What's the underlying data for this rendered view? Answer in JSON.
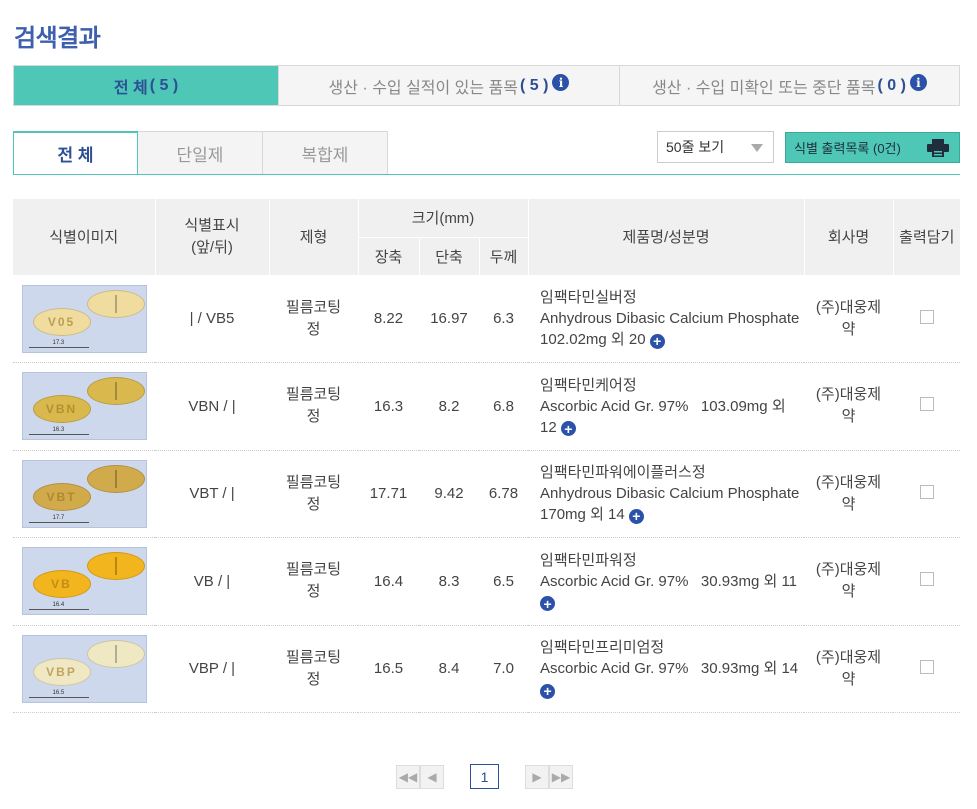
{
  "page_title": "검색결과",
  "top_tabs": [
    {
      "label": "전 체",
      "count": "( 5 )"
    },
    {
      "label": "생산 · 수입 실적이 있는 품목",
      "count": "( 5 )"
    },
    {
      "label": "생산 · 수입 미확인 또는 중단 품목",
      "count": "( 0 )"
    }
  ],
  "sub_tabs": [
    "전 체",
    "단일제",
    "복합제"
  ],
  "view_select": {
    "value": "50줄 보기"
  },
  "print_button": {
    "label": "식별 출력목록 (0건)"
  },
  "table": {
    "headers": {
      "image": "식별이미지",
      "marking": "식별표시\n(앞/뒤)",
      "form": "제형",
      "size": "크기(mm)",
      "long": "장축",
      "short": "단축",
      "thick": "두께",
      "product": "제품명/성분명",
      "company": "회사명",
      "print": "출력담기"
    },
    "rows": [
      {
        "marking": "| / VB5",
        "form": "필름코팅\n정",
        "long": "8.22",
        "short": "16.97",
        "thick": "6.3",
        "product": "임팩타민실버정",
        "ingredient": "Anhydrous Dibasic Calcium Phosphate   102.02mg 외 20",
        "company": "(주)대웅제\n약",
        "pill_color": "#efdc9e",
        "imprint": "V05",
        "scale_label": "17.3"
      },
      {
        "marking": "VBN / |",
        "form": "필름코팅\n정",
        "long": "16.3",
        "short": "8.2",
        "thick": "6.8",
        "product": "임팩타민케어정",
        "ingredient": "Ascorbic Acid Gr. 97%   103.09mg 외 12",
        "company": "(주)대웅제\n약",
        "pill_color": "#d9b94e",
        "imprint": "VBN",
        "scale_label": "16.3"
      },
      {
        "marking": "VBT / |",
        "form": "필름코팅\n정",
        "long": "17.71",
        "short": "9.42",
        "thick": "6.78",
        "product": "임팩타민파워에이플러스정",
        "ingredient": "Anhydrous Dibasic Calcium Phosphate   170mg 외 14",
        "company": "(주)대웅제\n약",
        "pill_color": "#d1aa4c",
        "imprint": "VBT",
        "scale_label": "17.7"
      },
      {
        "marking": "VB / |",
        "form": "필름코팅\n정",
        "long": "16.4",
        "short": "8.3",
        "thick": "6.5",
        "product": "임팩타민파워정",
        "ingredient": "Ascorbic Acid Gr. 97%   30.93mg 외 11",
        "company": "(주)대웅제\n약",
        "pill_color": "#f3b51d",
        "imprint": "VB",
        "scale_label": "16.4"
      },
      {
        "marking": "VBP / |",
        "form": "필름코팅\n정",
        "long": "16.5",
        "short": "8.4",
        "thick": "7.0",
        "product": "임팩타민프리미엄정",
        "ingredient": "Ascorbic Acid Gr. 97%   30.93mg 외 14",
        "company": "(주)대웅제\n약",
        "pill_color": "#efe8c2",
        "imprint": "VBP",
        "scale_label": "16.5"
      }
    ]
  },
  "pager": {
    "current": "1"
  },
  "colors": {
    "accent": "#4ec7b7",
    "brand_blue": "#2c4f96",
    "icon_blue": "#2b52a8"
  }
}
